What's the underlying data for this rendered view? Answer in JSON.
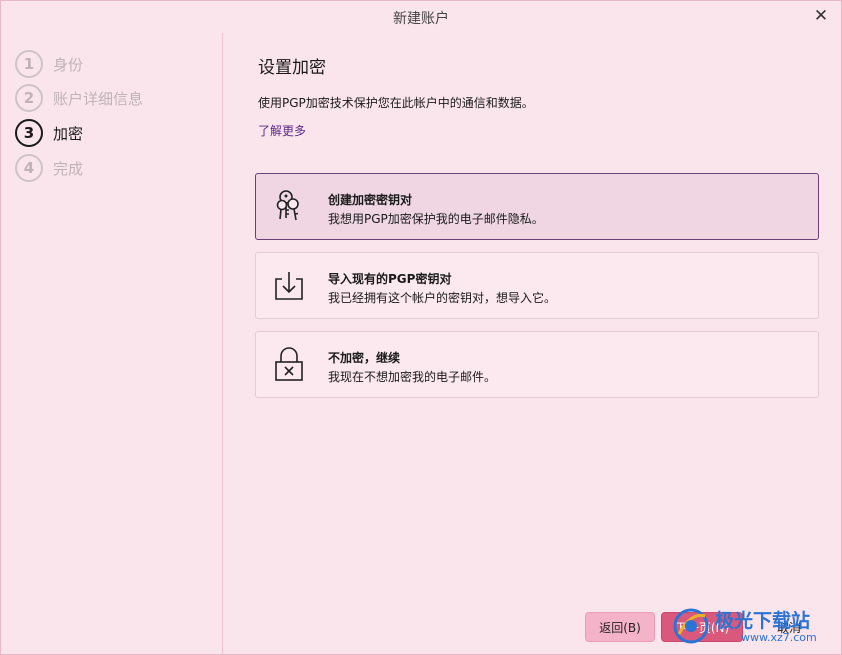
{
  "window": {
    "title": "新建账户",
    "close_label": "✕"
  },
  "steps": [
    {
      "num": "1",
      "label": "身份",
      "state": "done"
    },
    {
      "num": "2",
      "label": "账户详细信息",
      "state": "done"
    },
    {
      "num": "3",
      "label": "加密",
      "state": "active"
    },
    {
      "num": "4",
      "label": "完成",
      "state": "pending"
    }
  ],
  "main": {
    "heading": "设置加密",
    "description": "使用PGP加密技术保护您在此帐户中的通信和数据。",
    "learn_more": "了解更多"
  },
  "options": [
    {
      "icon": "keys-icon",
      "title": "创建加密密钥对",
      "subtitle": "我想用PGP加密保护我的电子邮件隐私。",
      "selected": true
    },
    {
      "icon": "import-icon",
      "title": "导入现有的PGP密钥对",
      "subtitle": "我已经拥有这个帐户的密钥对，想导入它。",
      "selected": false
    },
    {
      "icon": "lock-x-icon",
      "title": "不加密，继续",
      "subtitle": "我现在不想加密我的电子邮件。",
      "selected": false
    }
  ],
  "buttons": {
    "back": "返回(B)",
    "next": "下一页(N)",
    "cancel": "取消"
  },
  "watermark": {
    "name": "极光下载站",
    "url": "www.xz7.com"
  },
  "colors": {
    "background": "#fbe5ec",
    "selected_border": "#6b3f7a",
    "primary_button": "#d9587c",
    "link": "#5b2a86"
  }
}
